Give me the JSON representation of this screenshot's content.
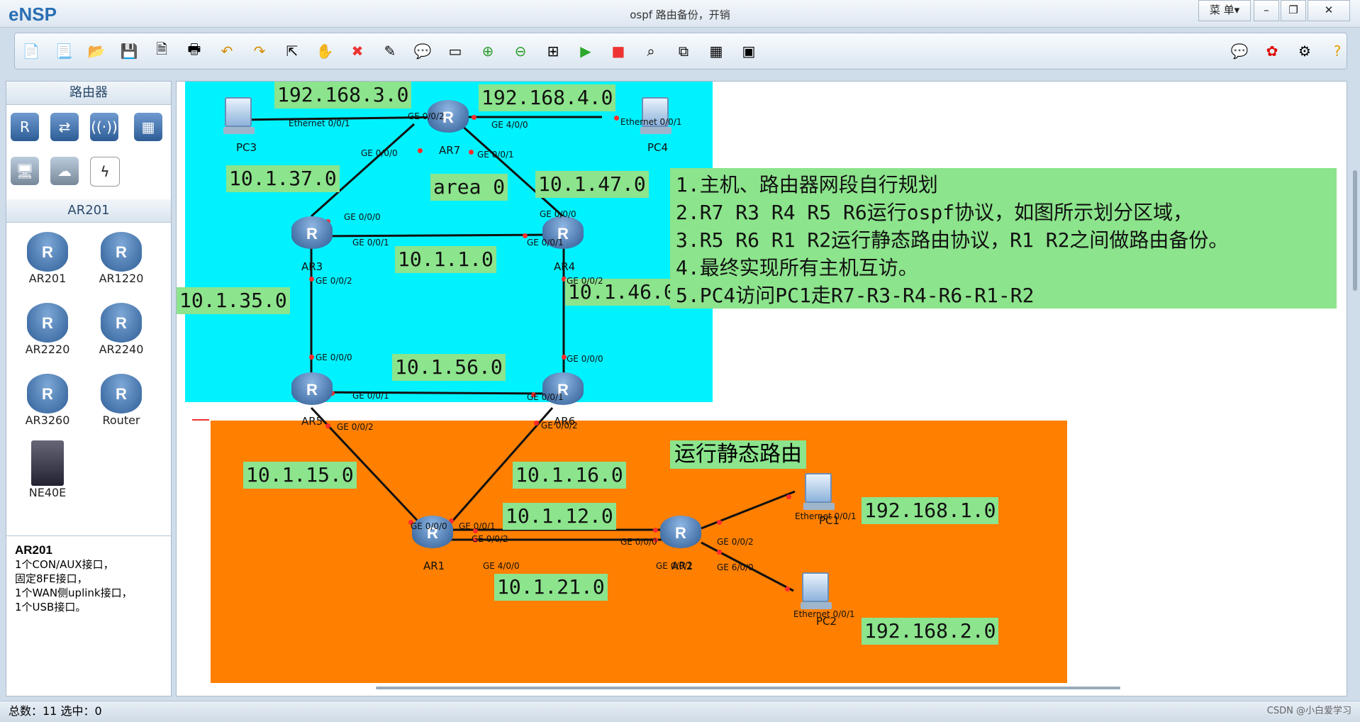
{
  "app": {
    "name": "eNSP",
    "title": "ospf 路由备份，开销",
    "menu": "菜 单▾"
  },
  "toolbar": {
    "icons": [
      "new-topo-icon",
      "new-file-icon",
      "open-icon",
      "save-icon",
      "save-as-icon",
      "print-icon",
      "undo-icon",
      "redo-icon",
      "select-icon",
      "pan-icon",
      "delete-icon",
      "delete-link-icon",
      "text-icon",
      "palette-icon",
      "zoom-in-icon",
      "zoom-out-icon",
      "fit-icon",
      "start-icon",
      "stop-icon",
      "capture-icon",
      "topology-icon",
      "grid-icon",
      "console-icon"
    ],
    "right_icons": [
      "chat-icon",
      "huawei-icon",
      "settings-icon",
      "help-icon"
    ]
  },
  "left_panel": {
    "header_routers": "路由器",
    "header_model": "AR201",
    "devices": [
      "AR201",
      "AR1220",
      "AR2220",
      "AR2240",
      "AR3260",
      "Router",
      "NE40E"
    ],
    "description": {
      "title": "AR201",
      "lines": [
        "1个CON/AUX接口，",
        "固定8FE接口，",
        "1个WAN侧uplink接口，",
        "1个USB接口。"
      ]
    }
  },
  "topology": {
    "nodes": {
      "pc3": "PC3",
      "ar7": "AR7",
      "pc4": "PC4",
      "ar3": "AR3",
      "ar4": "AR4",
      "ar5": "AR5",
      "ar6": "AR6",
      "ar1": "AR1",
      "ar2": "AR2",
      "pc1": "PC1",
      "pc2": "PC2"
    },
    "subnets": {
      "s1": "192.168.3.0",
      "s2": "192.168.4.0",
      "s3": "10.1.37.0",
      "s4": "area 0",
      "s5": "10.1.47.0",
      "s6": "10.1.1.0",
      "s7": "10.1.35.0",
      "s8": "10.1.46.0",
      "s9": "10.1.56.0",
      "s10": "10.1.15.0",
      "s11": "10.1.16.0",
      "s12": "10.1.12.0",
      "s13": "10.1.21.0",
      "s14": "192.168.1.0",
      "s15": "192.168.2.0"
    },
    "ports": {
      "p1": "Ethernet 0/0/1",
      "p2": "GE 0/0/2",
      "p3": "GE 4/0/0",
      "p4": "Ethernet 0/0/1",
      "p5": "GE 0/0/0",
      "p6": "GE 0/0/1",
      "p7": "GE 0/0/0",
      "p8": "GE 0/0/0",
      "p9": "GE 0/0/1",
      "p10": "GE 0/0/1",
      "p11": "GE 0/0/2",
      "p12": "GE 0/0/2",
      "p13": "GE 0/0/0",
      "p14": "GE 0/0/0",
      "p15": "GE 0/0/1",
      "p16": "GE 0/0/1",
      "p17": "GE 0/0/2",
      "p18": "GE 0/0/2",
      "p19": "GE 0/0/0",
      "p20": "GE 0/0/1",
      "p21": "GE 0/0/2",
      "p22": "GE 4/0/0",
      "p23": "GE 0/0/0",
      "p24": "GE 0/0/1",
      "p25": "GE 0/0/2",
      "p26": "GE 6/0/0",
      "p27": "Ethernet 0/0/1",
      "p28": "Ethernet 0/0/1"
    },
    "notes": [
      "1.主机、路由器网段自行规划",
      "2.R7 R3 R4 R5 R6运行ospf协议，如图所示划分区域，",
      "3.R5 R6 R1 R2运行静态路由协议，R1 R2之间做路由备份。",
      "4.最终实现所有主机互访。",
      "5.PC4访问PC1走R7-R3-R4-R6-R1-R2"
    ],
    "static_label": "运行静态路由"
  },
  "status": {
    "text": "总数：11 选中：0",
    "right": "CSDN @小白爱学习"
  }
}
